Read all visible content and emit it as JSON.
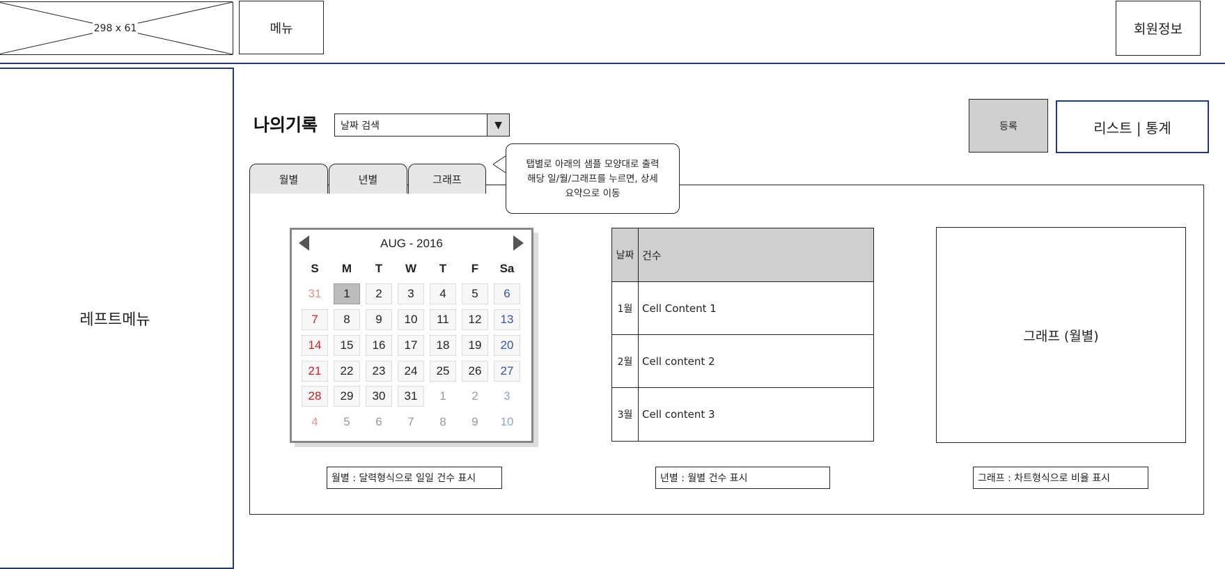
{
  "header": {
    "logo_placeholder": "298 x 61",
    "menu_label": "메뉴",
    "member_label": "회원정보"
  },
  "left_menu": {
    "label": "레프트메뉴"
  },
  "main": {
    "title": "나의기록",
    "date_search": {
      "value": "날짜 검색",
      "arrow": "▼"
    },
    "register_label": "등록",
    "view_toggle": "리스트 | 통계",
    "tabs": [
      {
        "label": "월별"
      },
      {
        "label": "년별"
      },
      {
        "label": "그래프"
      }
    ],
    "callout": {
      "line1": "탭별로 아래의 샘플 모양대로 출력",
      "line2": "해당 일/월/그래프를 누르면, 상세",
      "line3": "요약으로 이동"
    }
  },
  "calendar": {
    "month_label": "AUG - 2016",
    "weekdays": [
      "S",
      "M",
      "T",
      "W",
      "T",
      "F",
      "Sa"
    ],
    "weeks": [
      [
        "31",
        "1",
        "2",
        "3",
        "4",
        "5",
        "6"
      ],
      [
        "7",
        "8",
        "9",
        "10",
        "11",
        "12",
        "13"
      ],
      [
        "14",
        "15",
        "16",
        "17",
        "18",
        "19",
        "20"
      ],
      [
        "21",
        "22",
        "23",
        "24",
        "25",
        "26",
        "27"
      ],
      [
        "28",
        "29",
        "30",
        "31",
        "1",
        "2",
        "3"
      ],
      [
        "4",
        "5",
        "6",
        "7",
        "8",
        "9",
        "10"
      ]
    ],
    "selected": "1"
  },
  "table": {
    "headers": [
      "날짜",
      "건수"
    ],
    "rows": [
      [
        "1월",
        "Cell Content 1"
      ],
      [
        "2월",
        "Cell content 2"
      ],
      [
        "3월",
        "Cell content 3"
      ]
    ]
  },
  "graph": {
    "label": "그래프 (월별)"
  },
  "captions": {
    "monthly": "월별 : 달력형식으로 일일 건수 표시",
    "yearly": "년별 : 월별 건수 표시",
    "graph": "그래프 : 차트형식으로 비율 표시"
  },
  "colors": {
    "accent_border": "#1f3a7a",
    "sunday": "#cc2222",
    "saturday": "#3355aa",
    "header_fill": "#cfcfcf"
  }
}
